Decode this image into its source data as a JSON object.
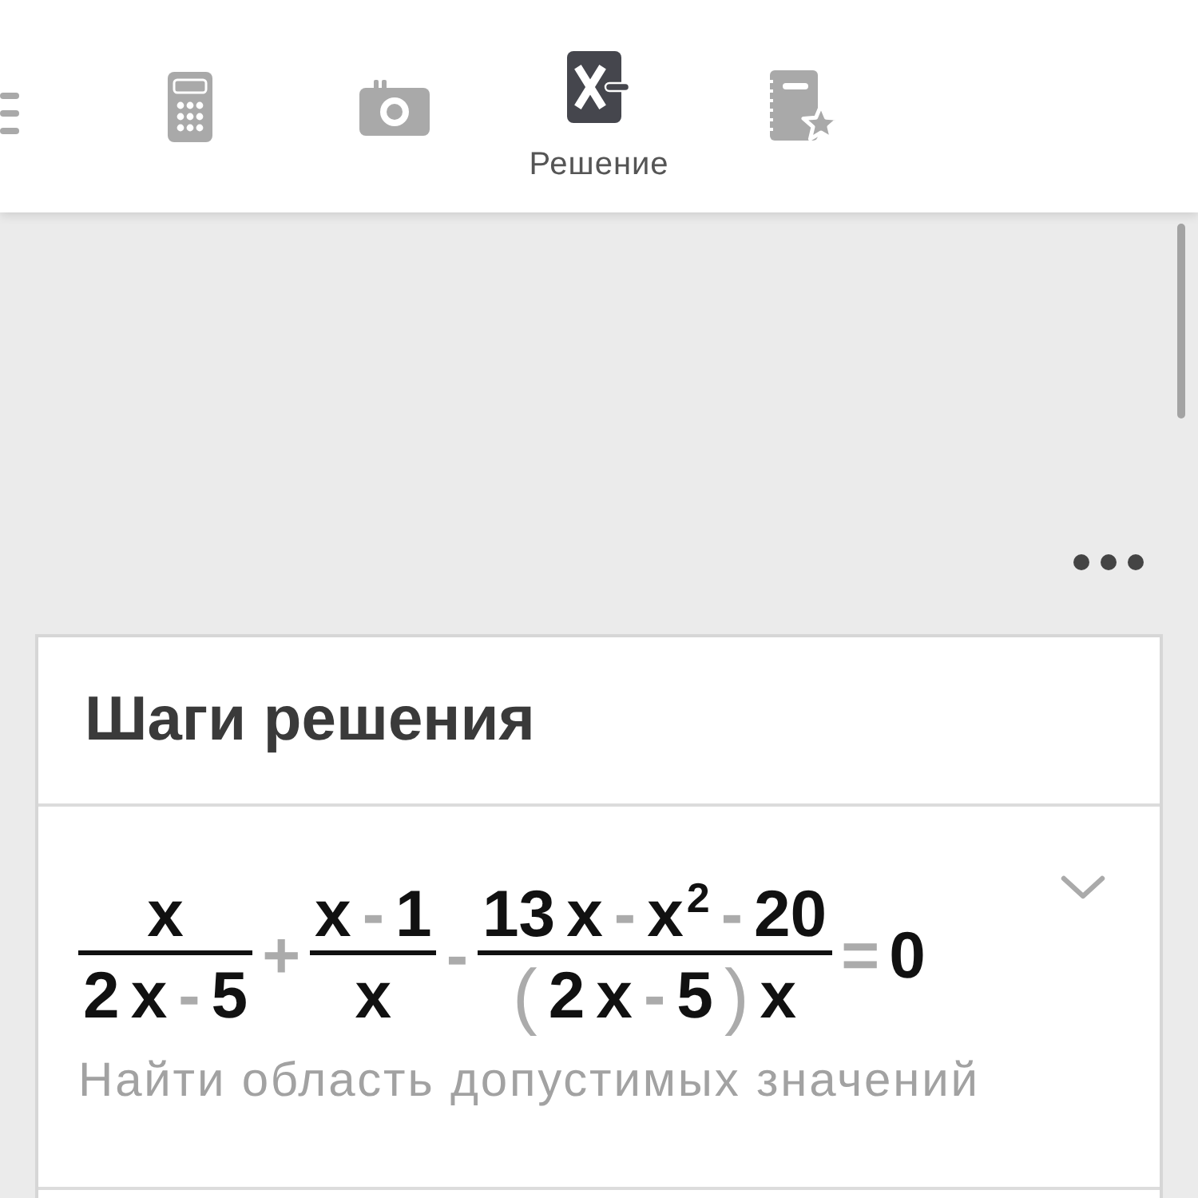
{
  "toolbar": {
    "tabs": [
      {
        "kind": "calculator",
        "selected": false
      },
      {
        "kind": "camera",
        "selected": false
      },
      {
        "kind": "solution",
        "selected": true,
        "label": "Решение"
      },
      {
        "kind": "notebook",
        "selected": false
      }
    ]
  },
  "steps_card": {
    "title": "Шаги решения",
    "steps": [
      {
        "expanded": false,
        "equation": [
          {
            "kind": "fraction",
            "numerator": [
              {
                "kind": "term",
                "text": "x"
              }
            ],
            "denominator": [
              {
                "kind": "term",
                "text": "2"
              },
              {
                "kind": "term",
                "text": "x"
              },
              {
                "kind": "operator",
                "text": "-"
              },
              {
                "kind": "term",
                "text": "5"
              }
            ]
          },
          {
            "kind": "operator",
            "text": "+"
          },
          {
            "kind": "fraction",
            "numerator": [
              {
                "kind": "term",
                "text": "x"
              },
              {
                "kind": "operator",
                "text": "-"
              },
              {
                "kind": "term",
                "text": "1"
              }
            ],
            "denominator": [
              {
                "kind": "term",
                "text": "x"
              }
            ]
          },
          {
            "kind": "operator",
            "text": "-"
          },
          {
            "kind": "fraction",
            "numerator": [
              {
                "kind": "term",
                "text": "13"
              },
              {
                "kind": "term",
                "text": "x"
              },
              {
                "kind": "operator",
                "text": "-"
              },
              {
                "kind": "term",
                "text": "x$^{2}$"
              },
              {
                "kind": "operator",
                "text": "-"
              },
              {
                "kind": "term",
                "text": "20"
              }
            ],
            "denominator": [
              {
                "kind": "paren",
                "text": "("
              },
              {
                "kind": "term",
                "text": "2"
              },
              {
                "kind": "term",
                "text": "x"
              },
              {
                "kind": "operator",
                "text": "-"
              },
              {
                "kind": "term",
                "text": "5"
              },
              {
                "kind": "paren",
                "text": ")"
              },
              {
                "kind": "term",
                "text": "x"
              }
            ]
          },
          {
            "kind": "operator",
            "text": "="
          },
          {
            "kind": "term",
            "text": "0"
          }
        ],
        "caption": "Найти область допустимых значений"
      }
    ]
  }
}
